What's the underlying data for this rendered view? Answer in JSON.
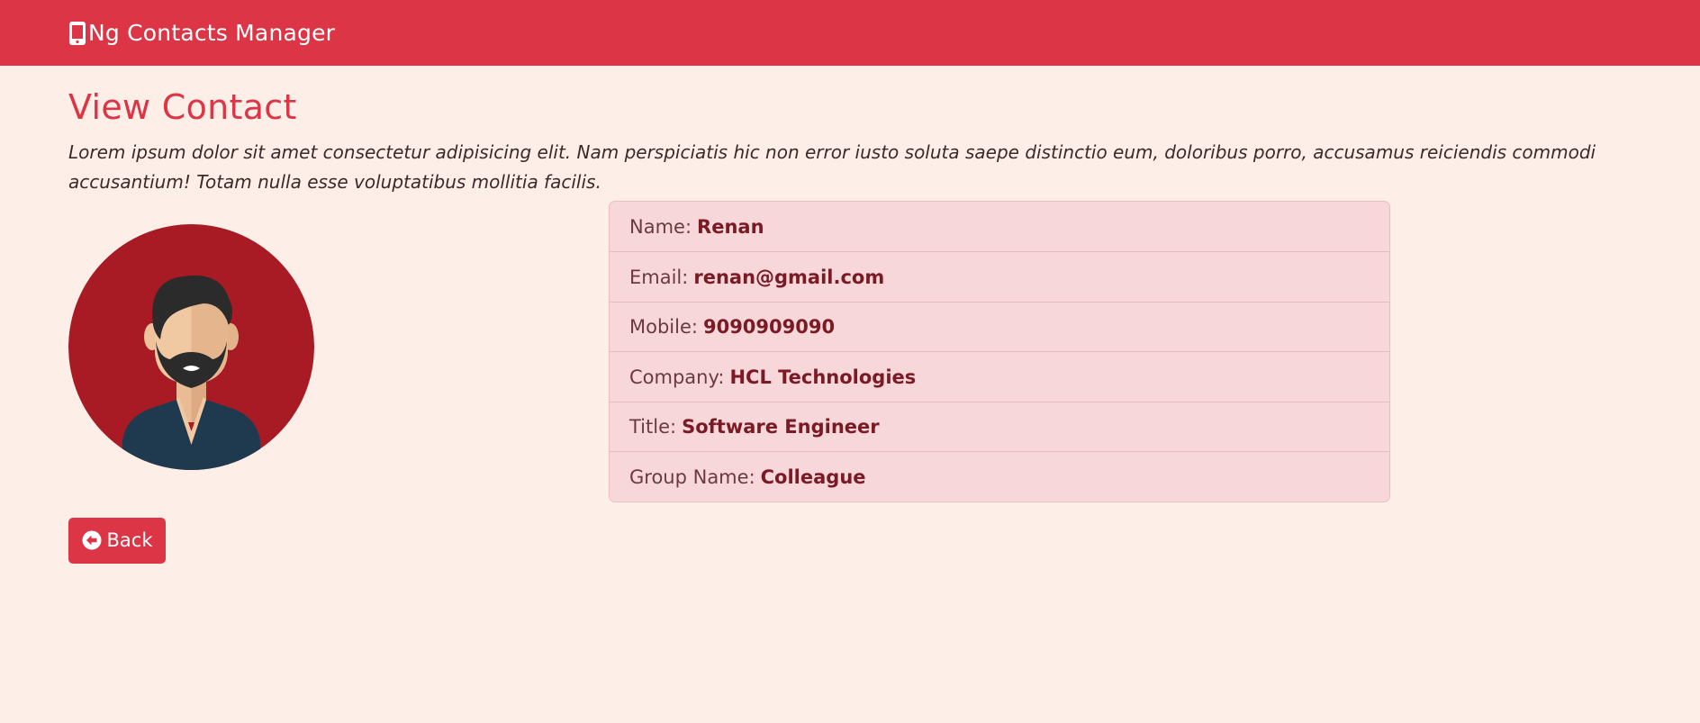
{
  "navbar": {
    "brand_label": "Ng Contacts Manager",
    "brand_icon": "mobile-phone-icon"
  },
  "page": {
    "title": "View Contact",
    "description": "Lorem ipsum dolor sit amet consectetur adipisicing elit. Nam perspiciatis hic non error iusto soluta saepe distinctio eum, doloribus porro, accusamus reiciendis commodi accusantium! Totam nulla esse voluptatibus mollitia facilis."
  },
  "avatar": {
    "icon": "user-avatar-icon"
  },
  "contact": {
    "name_label": "Name:",
    "name": "Renan",
    "email_label": "Email:",
    "email": "renan@gmail.com",
    "mobile_label": "Mobile:",
    "mobile": "9090909090",
    "company_label": "Company:",
    "company": "HCL Technologies",
    "title_label": "Title:",
    "title": "Software Engineer",
    "group_label": "Group Name:",
    "group": "Colleague"
  },
  "actions": {
    "back_label": "Back",
    "back_icon": "arrow-circle-left-icon"
  },
  "colors": {
    "primary": "#dc3545",
    "background": "#fdeee8",
    "list_background": "#f8d7da",
    "value_text": "#7a1a25"
  }
}
